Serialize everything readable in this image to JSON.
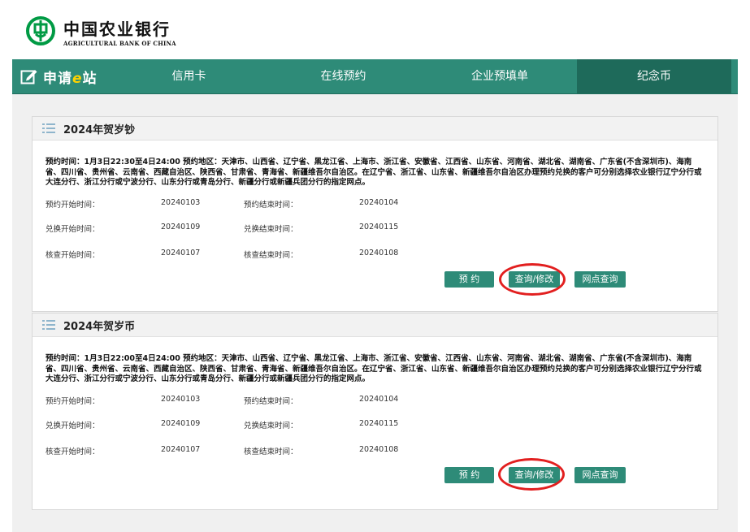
{
  "bank": {
    "name_cn": "中国农业银行",
    "name_en": "AGRICULTURAL BANK OF CHINA"
  },
  "nav": {
    "brand_pre": "申请",
    "brand_e": "e",
    "brand_post": "站",
    "items": [
      {
        "label": "信用卡"
      },
      {
        "label": "在线预约"
      },
      {
        "label": "企业预填单"
      },
      {
        "label": "纪念币"
      }
    ],
    "active": "纪念币"
  },
  "cards": [
    {
      "title": "2024年贺岁钞",
      "desc": "预约时间：1月3日22:30至4日24:00 预约地区：天津市、山西省、辽宁省、黑龙江省、上海市、浙江省、安徽省、江西省、山东省、河南省、湖北省、湖南省、广东省(不含深圳市)、海南省、四川省、贵州省、云南省、西藏自治区、陕西省、甘肃省、青海省、新疆维吾尔自治区。在辽宁省、浙江省、山东省、新疆维吾尔自治区办理预约兑换的客户可分别选择农业银行辽宁分行或大连分行、浙江分行或宁波分行、山东分行或青岛分行、新疆分行或新疆兵团分行的指定网点。",
      "rows": [
        {
          "l1": "预约开始时间：",
          "v1": "20240103",
          "l2": "预约结束时间：",
          "v2": "20240104"
        },
        {
          "l1": "兑换开始时间：",
          "v1": "20240109",
          "l2": "兑换结束时间：",
          "v2": "20240115"
        },
        {
          "l1": "核查开始时间：",
          "v1": "20240107",
          "l2": "核查结束时间：",
          "v2": "20240108"
        }
      ],
      "buttons": {
        "reserve": "预 约",
        "query": "查询/修改",
        "branch": "网点查询"
      }
    },
    {
      "title": "2024年贺岁币",
      "desc": "预约时间：1月3日22:00至4日24:00 预约地区：天津市、山西省、辽宁省、黑龙江省、上海市、浙江省、安徽省、江西省、山东省、河南省、湖北省、湖南省、广东省(不含深圳市)、海南省、四川省、贵州省、云南省、西藏自治区、陕西省、甘肃省、青海省、新疆维吾尔自治区。在辽宁省、浙江省、山东省、新疆维吾尔自治区办理预约兑换的客户可分别选择农业银行辽宁分行或大连分行、浙江分行或宁波分行、山东分行或青岛分行、新疆分行或新疆兵团分行的指定网点。",
      "rows": [
        {
          "l1": "预约开始时间：",
          "v1": "20240103",
          "l2": "预约结束时间：",
          "v2": "20240104"
        },
        {
          "l1": "兑换开始时间：",
          "v1": "20240109",
          "l2": "兑换结束时间：",
          "v2": "20240115"
        },
        {
          "l1": "核查开始时间：",
          "v1": "20240107",
          "l2": "核查结束时间：",
          "v2": "20240108"
        }
      ],
      "buttons": {
        "reserve": "预 约",
        "query": "查询/修改",
        "branch": "网点查询"
      }
    }
  ],
  "colors": {
    "nav": "#2e8b78",
    "nav_active": "#1e6a5a",
    "button": "#2e8b78",
    "highlight_ring": "#e21f1f",
    "logo": "#009a44"
  }
}
